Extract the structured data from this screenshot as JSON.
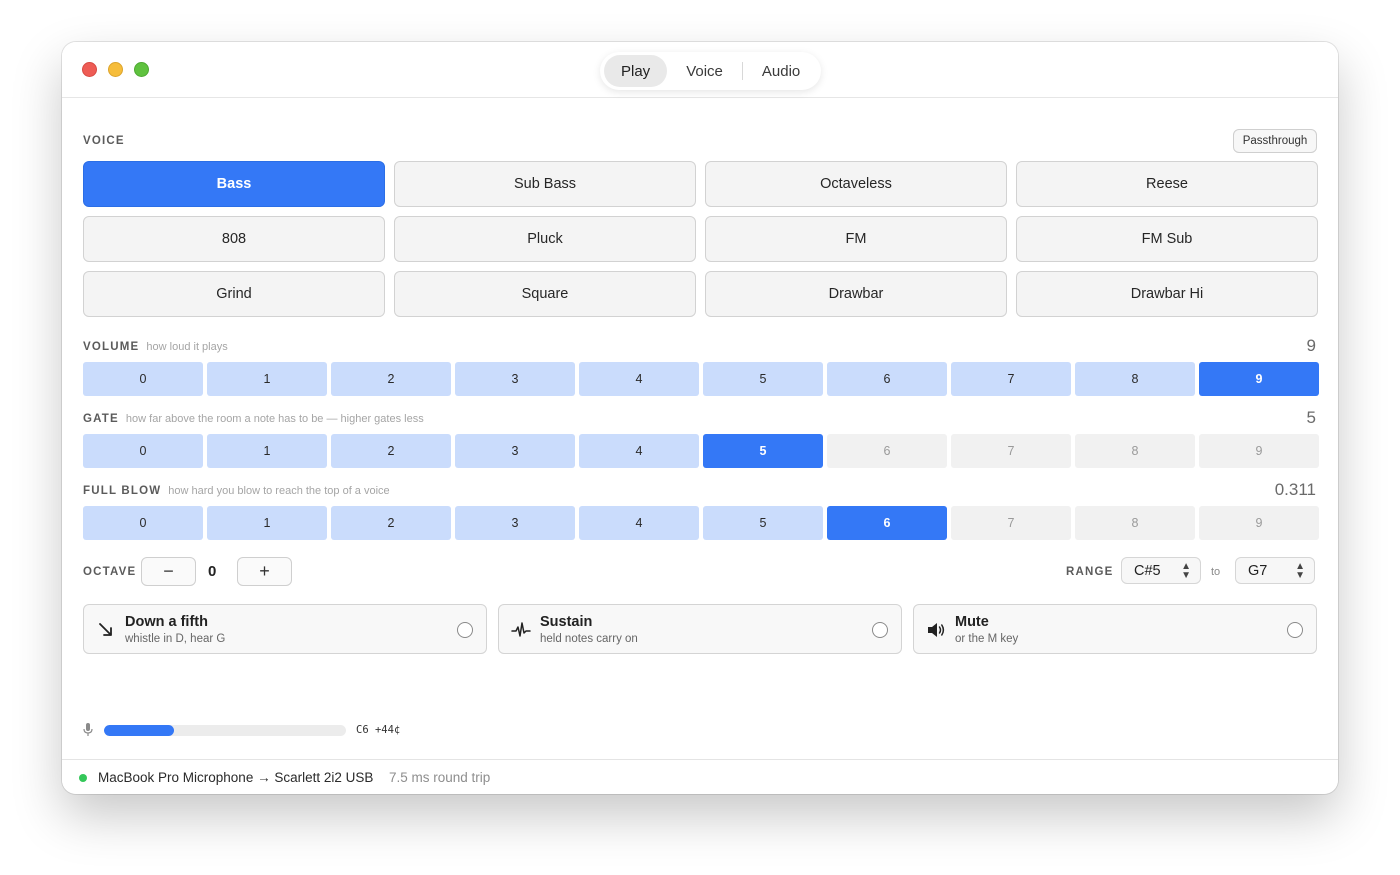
{
  "tabs": [
    {
      "label": "Play",
      "active": true
    },
    {
      "label": "Voice",
      "active": false
    },
    {
      "label": "Audio",
      "active": false
    }
  ],
  "voice": {
    "label": "VOICE",
    "passthrough_label": "Passthrough",
    "selected": "Bass",
    "options": [
      "Bass",
      "Sub Bass",
      "Octaveless",
      "Reese",
      "808",
      "Pluck",
      "FM",
      "FM Sub",
      "Grind",
      "Square",
      "Drawbar",
      "Drawbar Hi"
    ]
  },
  "volume": {
    "label": "VOLUME",
    "hint": "how loud it plays",
    "value_display": "9",
    "selected": 9,
    "steps": [
      "0",
      "1",
      "2",
      "3",
      "4",
      "5",
      "6",
      "7",
      "8",
      "9"
    ]
  },
  "gate": {
    "label": "GATE",
    "hint": "how far above the room a note has to be — higher gates less",
    "value_display": "5",
    "selected": 5,
    "steps": [
      "0",
      "1",
      "2",
      "3",
      "4",
      "5",
      "6",
      "7",
      "8",
      "9"
    ]
  },
  "full_blow": {
    "label": "FULL BLOW",
    "hint": "how hard you blow to reach the top of a voice",
    "value_display": "0.311",
    "selected": 6,
    "steps": [
      "0",
      "1",
      "2",
      "3",
      "4",
      "5",
      "6",
      "7",
      "8",
      "9"
    ]
  },
  "octave": {
    "label": "OCTAVE",
    "minus": "−",
    "plus": "+",
    "value": "0"
  },
  "range": {
    "label": "RANGE",
    "from": "C#5",
    "to_label": "to",
    "to": "G7"
  },
  "toggles": [
    {
      "title": "Down a fifth",
      "subtitle": "whistle in D, hear G",
      "icon": "arrow-down-right-icon",
      "checked": false
    },
    {
      "title": "Sustain",
      "subtitle": "held notes carry on",
      "icon": "waveform-icon",
      "checked": false
    },
    {
      "title": "Mute",
      "subtitle": "or the M key",
      "icon": "speaker-icon",
      "checked": false
    }
  ],
  "input_meter": {
    "level": 0.29,
    "pitch_readout": "C6 +44¢"
  },
  "status": {
    "route": "MacBook Pro Microphone → Scarlett 2i2 USB",
    "latency": "7.5 ms round trip",
    "dot_color": "#34c759"
  },
  "colors": {
    "accent": "#3478f6",
    "accent_light": "#cadcfc"
  }
}
